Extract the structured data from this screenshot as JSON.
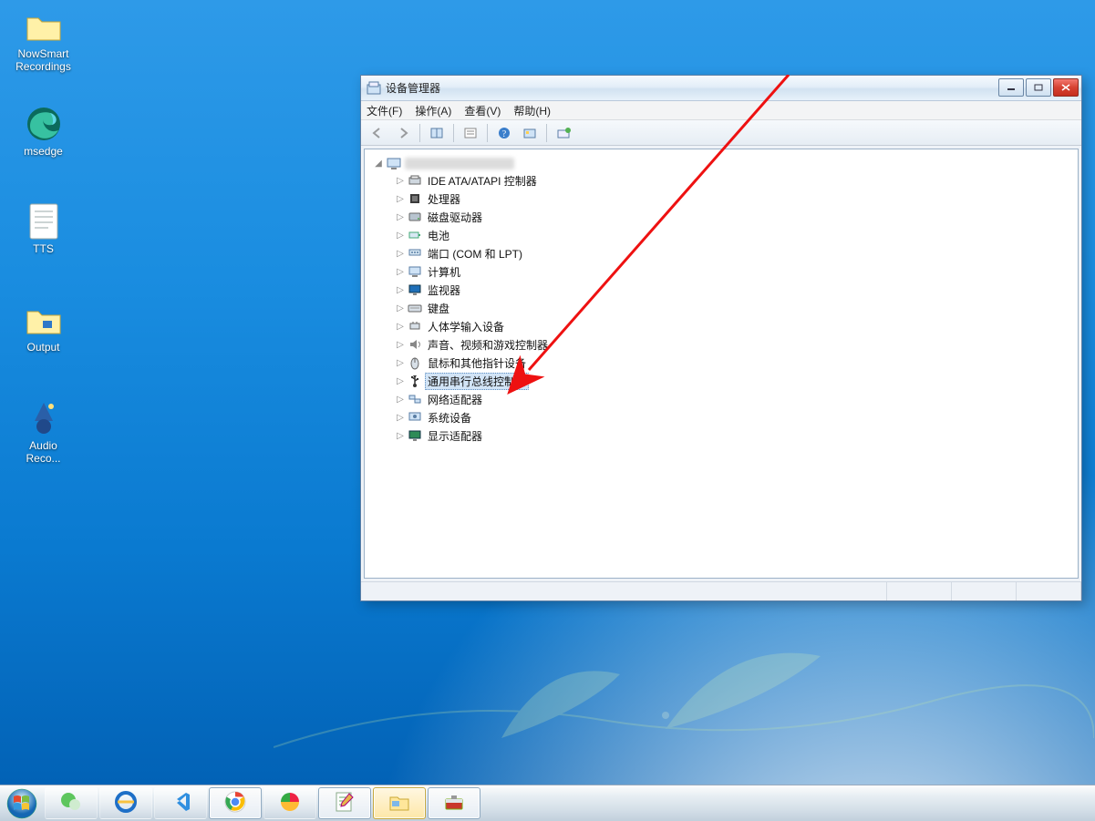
{
  "desktop_icons": [
    {
      "name": "recordings-folder",
      "label": "NowSmart\nRecordings",
      "kind": "folder"
    },
    {
      "name": "msedge",
      "label": "msedge",
      "kind": "edge"
    },
    {
      "name": "tts-file",
      "label": "TTS",
      "kind": "text"
    },
    {
      "name": "output-folder",
      "label": "Output",
      "kind": "folder"
    },
    {
      "name": "audio-reco",
      "label": "Audio\nReco...",
      "kind": "app"
    }
  ],
  "window": {
    "title": "设备管理器",
    "menus": {
      "file": "文件(F)",
      "action": "操作(A)",
      "view": "查看(V)",
      "help": "帮助(H)"
    },
    "tree": {
      "nodes": [
        {
          "label": "IDE ATA/ATAPI 控制器",
          "icon": "ide-icon"
        },
        {
          "label": "处理器",
          "icon": "cpu-icon"
        },
        {
          "label": "磁盘驱动器",
          "icon": "disk-icon"
        },
        {
          "label": "电池",
          "icon": "battery-icon"
        },
        {
          "label": "端口 (COM 和 LPT)",
          "icon": "port-icon"
        },
        {
          "label": "计算机",
          "icon": "computer-icon"
        },
        {
          "label": "监视器",
          "icon": "monitor-icon"
        },
        {
          "label": "键盘",
          "icon": "keyboard-icon"
        },
        {
          "label": "人体学输入设备",
          "icon": "hid-icon"
        },
        {
          "label": "声音、视频和游戏控制器",
          "icon": "sound-icon"
        },
        {
          "label": "鼠标和其他指针设备",
          "icon": "mouse-icon"
        },
        {
          "label": "通用串行总线控制器",
          "icon": "usb-icon",
          "selected": true
        },
        {
          "label": "网络适配器",
          "icon": "network-icon"
        },
        {
          "label": "系统设备",
          "icon": "system-icon"
        },
        {
          "label": "显示适配器",
          "icon": "display-icon"
        }
      ]
    }
  },
  "taskbar_items": [
    {
      "name": "wechat",
      "state": "inactive"
    },
    {
      "name": "ie",
      "state": "inactive"
    },
    {
      "name": "vscode",
      "state": "inactive"
    },
    {
      "name": "chrome",
      "state": "running"
    },
    {
      "name": "app-green",
      "state": "inactive"
    },
    {
      "name": "notepadpp",
      "state": "running"
    },
    {
      "name": "explorer",
      "state": "active"
    },
    {
      "name": "toolbox",
      "state": "running"
    }
  ]
}
